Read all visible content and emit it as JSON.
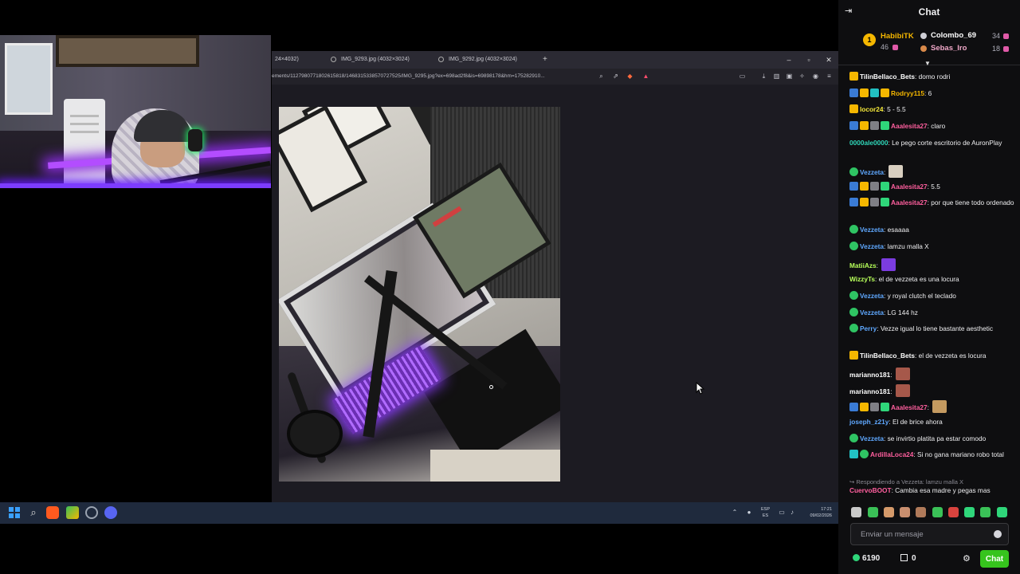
{
  "browser": {
    "tabs": [
      {
        "label": "24×4032)"
      },
      {
        "label": "IMG_9293.jpg (4032×3024)"
      },
      {
        "label": "IMG_9292.jpg (4032×3024)"
      }
    ],
    "new_tab": "+",
    "url": "ements/1127980771802615818/1468315338570727525/IMG_9295.jpg?ex=698ad2f8&is=69898178&hm=175282910..."
  },
  "taskbar": {
    "lang_top": "ESP",
    "lang_bottom": "ES",
    "time": "17:21",
    "date": "09/02/2026"
  },
  "chat": {
    "title": "Chat",
    "leaderboard": [
      {
        "name": "HabibiTK",
        "count": "46",
        "color": "#f5b700"
      },
      {
        "name": "Colombo_69",
        "count": "34",
        "color": "#ffffff"
      },
      {
        "name": "Sebas_Iro",
        "count": "18",
        "color": "#f0a8c8"
      }
    ],
    "messages": [
      {
        "user": "TilinBellaco_Bets",
        "color": "#ffffff",
        "text": ": domo rodri",
        "badges": [
          "crown"
        ]
      },
      {
        "user": "Rodryy115",
        "color": "#f5b700",
        "text": ": 6",
        "badges": [
          "prime",
          "crown",
          "teal",
          "gold"
        ]
      },
      {
        "user": "locor24",
        "color": "#f5e93a",
        "text": ": 5 - 5.5",
        "badges": [
          "crown"
        ]
      },
      {
        "user": "Aaalesita27",
        "color": "#ff5f9e",
        "text": ": claro",
        "badges": [
          "prime",
          "crown",
          "sub",
          "gift"
        ]
      },
      {
        "user": "0000ale0000",
        "color": "#2fd6b8",
        "text": ": Le pego corte escritorio de AuronPlay",
        "badges": []
      },
      {
        "user": "Vezzeta",
        "color": "#5fa8ff",
        "text": ":",
        "badges": [
          "ver"
        ]
      },
      {
        "user": "Aaalesita27",
        "color": "#ff5f9e",
        "text": ": 5.5",
        "badges": [
          "prime",
          "crown",
          "sub",
          "gift"
        ]
      },
      {
        "user": "Aaalesita27",
        "color": "#ff5f9e",
        "text": ": por que tiene todo ordenado",
        "badges": [
          "prime",
          "crown",
          "sub",
          "gift"
        ]
      },
      {
        "user": "Vezzeta",
        "color": "#5fa8ff",
        "text": ": esaaaa",
        "badges": [
          "ver"
        ]
      },
      {
        "user": "Vezzeta",
        "color": "#5fa8ff",
        "text": ": lamzu malla X",
        "badges": [
          "ver"
        ]
      },
      {
        "user": "MatiiAzs",
        "color": "#b7ff5a",
        "text": ":",
        "badges": []
      },
      {
        "user": "WizzyTs",
        "color": "#b7ff5a",
        "text": ": el de vezzeta es una locura",
        "badges": []
      },
      {
        "user": "Vezzeta",
        "color": "#5fa8ff",
        "text": ": y royal clutch el teclado",
        "badges": [
          "ver"
        ]
      },
      {
        "user": "Vezzeta",
        "color": "#5fa8ff",
        "text": ": LG 144 hz",
        "badges": [
          "ver"
        ]
      },
      {
        "user": "Perry",
        "color": "#5fa8ff",
        "text": ": Vezze igual lo tiene bastante aesthetic",
        "badges": [
          "ver"
        ]
      },
      {
        "user": "TilinBellaco_Bets",
        "color": "#ffffff",
        "text": ": el de vezzeta es locura",
        "badges": [
          "crown"
        ]
      },
      {
        "user": "marianno181",
        "color": "#ffffff",
        "text": ":",
        "badges": []
      },
      {
        "user": "marianno181",
        "color": "#ffffff",
        "text": ":",
        "badges": []
      },
      {
        "user": "Aaalesita27",
        "color": "#ff5f9e",
        "text": ":",
        "badges": [
          "prime",
          "crown",
          "sub",
          "gift"
        ]
      },
      {
        "user": "joseph_z21y",
        "color": "#5fa8ff",
        "text": ": El de brice ahora",
        "badges": []
      },
      {
        "user": "Vezzeta",
        "color": "#5fa8ff",
        "text": ": se invirtio platita pa estar comodo",
        "badges": [
          "ver"
        ]
      },
      {
        "user": "ArdillaLoca24",
        "color": "#ff5f9e",
        "text": ": Si no gana mariano robo total",
        "badges": [
          "teal",
          "ver"
        ]
      },
      {
        "user": "CuervoBOOT",
        "color": "#ff5f9e",
        "text": ": Cambia esa madre y pegas mas",
        "badges": []
      }
    ],
    "reply_context": "↪ Respondiendo a Vezzeta: lamzu malla X",
    "input_placeholder": "Enviar un mensaje",
    "points": "6190",
    "store_count": "0",
    "chat_button": "Chat"
  }
}
